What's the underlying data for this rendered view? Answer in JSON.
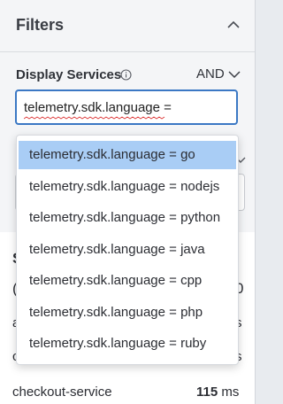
{
  "filters": {
    "title": "Filters",
    "display_services": {
      "label": "Display Services",
      "operator": "AND",
      "query": "telemetry.sdk.language ="
    }
  },
  "dropdown": {
    "options": [
      "telemetry.sdk.language = go",
      "telemetry.sdk.language = nodejs",
      "telemetry.sdk.language = python",
      "telemetry.sdk.language = java",
      "telemetry.sdk.language = cpp",
      "telemetry.sdk.language = php",
      "telemetry.sdk.language = ruby"
    ],
    "highlighted_index": 0
  },
  "background": {
    "fragments": [
      "S",
      "(",
      "a",
      "c",
      "0",
      "s",
      "s"
    ],
    "service_row": {
      "name": "checkout-service",
      "value": "115",
      "unit": "ms"
    }
  },
  "colors": {
    "accent": "#3b78c4",
    "highlight": "#a9cdf5",
    "panel_bg": "#f4f5f7"
  }
}
